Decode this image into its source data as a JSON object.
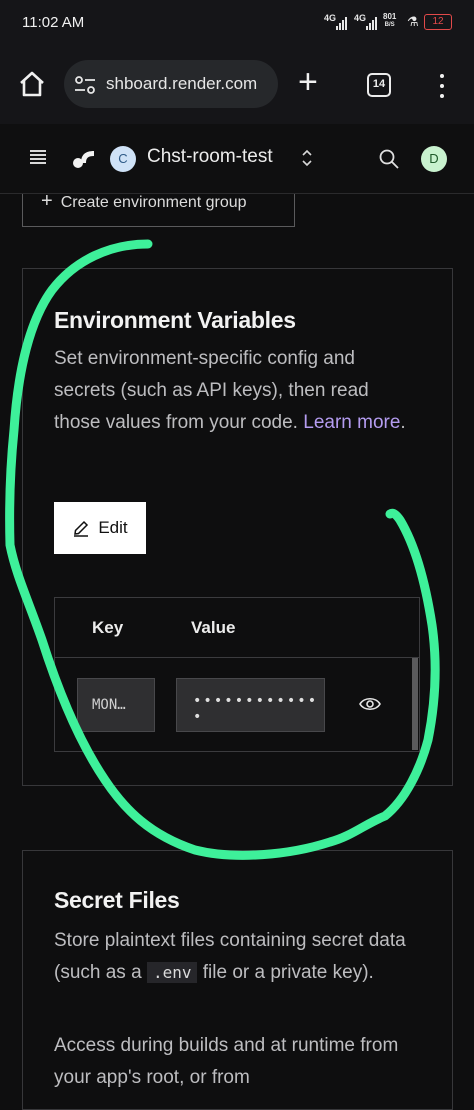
{
  "status_bar": {
    "time": "11:02 AM",
    "network_1": "4G",
    "network_2": "4G",
    "data_rate": "801",
    "data_rate_unit": "B/S",
    "battery": "12"
  },
  "browser": {
    "url": "shboard.render.com",
    "tab_count": "14"
  },
  "app_header": {
    "workspace_initial": "C",
    "project_name": "Chst-room-test",
    "user_initial": "D"
  },
  "env_group": {
    "create_label": "Create environment group"
  },
  "env_vars": {
    "title": "Environment Variables",
    "description": "Set environment-specific config and secrets (such as API keys), then read those values from your code.",
    "learn_more": "Learn more",
    "period": ".",
    "edit_label": "Edit",
    "columns": {
      "key": "Key",
      "value": "Value"
    },
    "rows": [
      {
        "key": "MON…",
        "value": "•••••••••••••"
      }
    ]
  },
  "secret_files": {
    "title": "Secret Files",
    "desc_before": "Store plaintext files containing secret data (such as a ",
    "desc_code": ".env",
    "desc_after": " file or a private key).",
    "desc2": "Access during builds and at runtime from your app's root, or from"
  },
  "colors": {
    "annotation_stroke": "#3ef09a",
    "link": "#b49cf0",
    "battery_low": "#e24a4a"
  }
}
